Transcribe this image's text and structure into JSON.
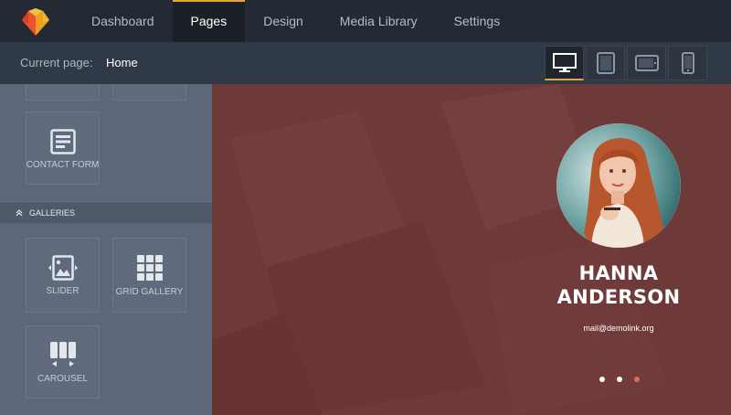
{
  "nav": {
    "items": [
      {
        "label": "Dashboard"
      },
      {
        "label": "Pages"
      },
      {
        "label": "Design"
      },
      {
        "label": "Media Library"
      },
      {
        "label": "Settings"
      }
    ],
    "active": "Pages"
  },
  "subbar": {
    "current_label": "Current page:",
    "current_value": "Home",
    "devices": [
      "desktop-icon",
      "tablet-icon",
      "tablet-landscape-icon",
      "mobile-icon"
    ]
  },
  "sidebar": {
    "contact_form_label": "CONTACT FORM",
    "galleries_label": "GALLERIES",
    "slider_label": "SLIDER",
    "grid_gallery_label": "GRID GALLERY",
    "carousel_label": "CAROUSEL"
  },
  "preview": {
    "name": "HANNA ANDERSON",
    "email": "mail@demolink.org",
    "slides_count": 3,
    "active_slide": 3
  },
  "colors": {
    "accent": "#e8a33d",
    "canvas_bg": "#6e3a39",
    "sidebar_bg": "#5c6779",
    "dot_active": "#e2695a"
  }
}
